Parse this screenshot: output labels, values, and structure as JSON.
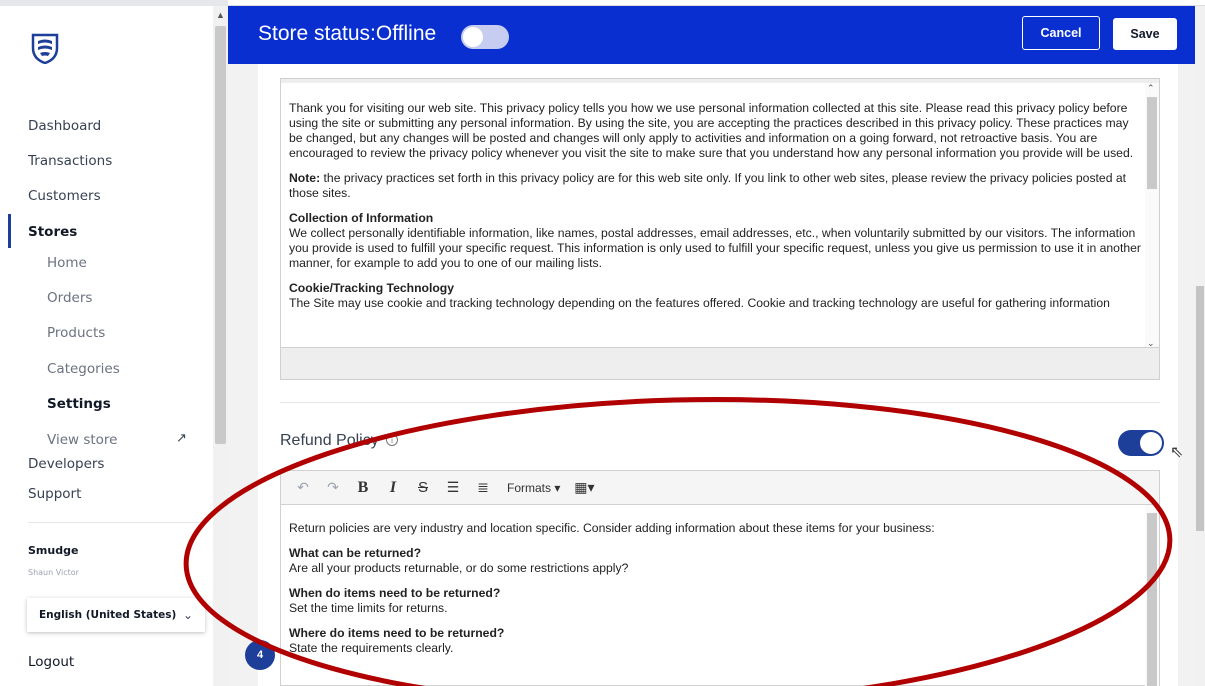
{
  "sidebar": {
    "nav": [
      {
        "label": "Dashboard"
      },
      {
        "label": "Transactions"
      },
      {
        "label": "Customers"
      },
      {
        "label": "Stores"
      }
    ],
    "stores_sub": [
      {
        "label": "Home"
      },
      {
        "label": "Orders"
      },
      {
        "label": "Products"
      },
      {
        "label": "Categories"
      },
      {
        "label": "Settings"
      },
      {
        "label": "View store"
      }
    ],
    "developers": "Developers",
    "support": "Support",
    "user_name": "Smudge",
    "user_sub": "Shaun Victor",
    "language": "English (United States)",
    "logout": "Logout",
    "badge_count": "4"
  },
  "header": {
    "store_status": "Store status:Offline",
    "cancel": "Cancel",
    "save": "Save"
  },
  "privacy_policy": {
    "p1": "Thank you for visiting our web site. This privacy policy tells you how we use personal information collected at this site. Please read this privacy policy before using the site or submitting any personal information. By using the site, you are accepting the practices described in this privacy policy. These practices may be changed, but any changes will be posted and changes will only apply to activities and information on a going forward, not retroactive basis. You are encouraged to review the privacy policy whenever you visit the site to make sure that you understand how any personal information you provide will be used.",
    "note_label": "Note:",
    "note_text": " the privacy practices set forth in this privacy policy are for this web site only. If you link to other web sites, please review the privacy policies posted at those sites.",
    "collection_heading": "Collection of Information",
    "collection_text": "We collect personally identifiable information, like names, postal addresses, email addresses, etc., when voluntarily submitted by our visitors. The information you provide is used to fulfill your specific request. This information is only used to fulfill your specific request, unless you give us permission to use it in another manner, for example to add you to one of our mailing lists.",
    "cookie_heading": "Cookie/Tracking Technology",
    "cookie_text": "The Site may use cookie and tracking technology depending on the features offered. Cookie and tracking technology are useful for gathering information"
  },
  "refund_policy": {
    "label": "Refund Policy",
    "enabled": true,
    "toolbar_formats": "Formats",
    "intro": "Return policies are very industry and location specific. Consider adding information about these items for your business:",
    "q1": "What can be returned?",
    "a1": "Are all your products returnable, or do some restrictions apply?",
    "q2": "When do items need to be returned?",
    "a2": "Set the time limits for returns.",
    "q3": "Where do items need to be returned?",
    "a3": "State the requirements clearly."
  },
  "colors": {
    "header_blue": "#0a2fd1",
    "brand_navy": "#1d3f9a",
    "annotation_red": "#b00000"
  }
}
